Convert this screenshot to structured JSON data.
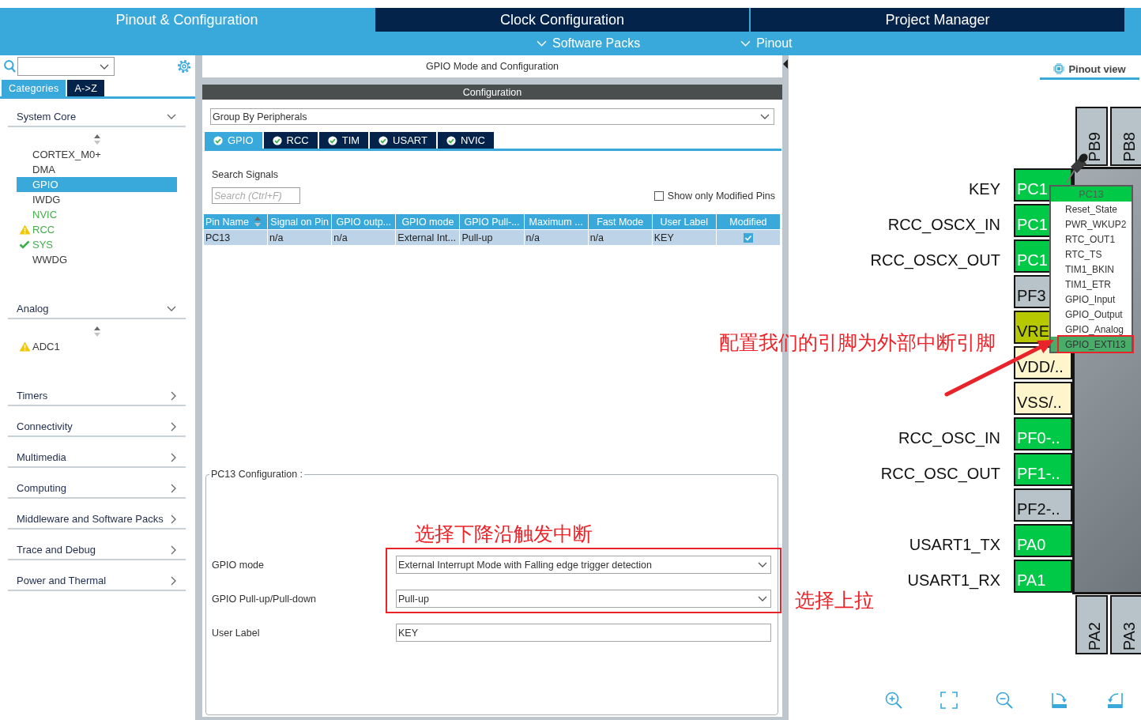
{
  "top_tabs": [
    {
      "label": "Pinout & Configuration",
      "selected": true
    },
    {
      "label": "Clock Configuration",
      "selected": false
    },
    {
      "label": "Project Manager",
      "selected": false
    }
  ],
  "menus": [
    {
      "label": "Software Packs"
    },
    {
      "label": "Pinout"
    }
  ],
  "sidebar": {
    "view_tabs": [
      {
        "label": "Categories",
        "selected": true
      },
      {
        "label": "A->Z",
        "selected": false
      }
    ],
    "categories": [
      {
        "label": "System Core",
        "expanded": true,
        "items": [
          {
            "label": "CORTEX_M0+",
            "selected": false,
            "configured": false,
            "kind": "plain"
          },
          {
            "label": "DMA",
            "selected": false,
            "configured": false,
            "kind": "plain"
          },
          {
            "label": "GPIO",
            "selected": true,
            "configured": false,
            "kind": "plain"
          },
          {
            "label": "IWDG",
            "selected": false,
            "configured": false,
            "kind": "plain"
          },
          {
            "label": "NVIC",
            "selected": false,
            "configured": true,
            "kind": "plain"
          },
          {
            "label": "RCC",
            "selected": false,
            "configured": true,
            "kind": "warning"
          },
          {
            "label": "SYS",
            "selected": false,
            "configured": true,
            "kind": "ok"
          },
          {
            "label": "WWDG",
            "selected": false,
            "configured": false,
            "kind": "plain"
          }
        ]
      },
      {
        "label": "Analog",
        "expanded": true,
        "items": [
          {
            "label": "ADC1",
            "selected": false,
            "configured": false,
            "kind": "warning"
          }
        ]
      },
      {
        "label": "Timers",
        "expanded": false
      },
      {
        "label": "Connectivity",
        "expanded": false
      },
      {
        "label": "Multimedia",
        "expanded": false
      },
      {
        "label": "Computing",
        "expanded": false
      },
      {
        "label": "Middleware and Software Packs",
        "expanded": false
      },
      {
        "label": "Trace and Debug",
        "expanded": false
      },
      {
        "label": "Power and Thermal",
        "expanded": false
      }
    ]
  },
  "config": {
    "title": "GPIO Mode and Configuration",
    "header": "Configuration",
    "group_by": "Group By Peripherals",
    "peripheral_tabs": [
      {
        "label": "GPIO",
        "selected": true
      },
      {
        "label": "RCC",
        "selected": false
      },
      {
        "label": "TIM",
        "selected": false
      },
      {
        "label": "USART",
        "selected": false
      },
      {
        "label": "NVIC",
        "selected": false
      }
    ],
    "search": {
      "label": "Search Signals",
      "placeholder": "Search (Ctrl+F)"
    },
    "modified_filter": {
      "label": "Show only Modified Pins",
      "checked": false
    },
    "table": {
      "columns": [
        "Pin Name",
        "Signal on Pin",
        "GPIO outp...",
        "GPIO mode",
        "GPIO Pull-...",
        "Maximum ...",
        "Fast Mode",
        "User Label",
        "Modified"
      ],
      "rows": [
        {
          "cells": [
            "PC13",
            "n/a",
            "n/a",
            "External Int...",
            "Pull-up",
            "n/a",
            "n/a",
            "KEY"
          ],
          "modified": true
        }
      ]
    },
    "pin_config": {
      "title": "PC13 Configuration :",
      "fields": [
        {
          "label": "GPIO mode",
          "kind": "dropdown",
          "value": "External Interrupt Mode with Falling edge trigger detection"
        },
        {
          "label": "GPIO Pull-up/Pull-down",
          "kind": "dropdown",
          "value": "Pull-up"
        },
        {
          "label": "User Label",
          "kind": "text",
          "value": "KEY"
        }
      ]
    }
  },
  "pinout": {
    "view_tab": {
      "label": "Pinout view",
      "selected": true
    },
    "top_pins": [
      {
        "name": "PB9",
        "kind": "unused"
      },
      {
        "name": "PB8",
        "kind": "unused"
      }
    ],
    "left_pins": [
      {
        "signal": "KEY",
        "name": "PC1",
        "kind": "assigned"
      },
      {
        "signal": "RCC_OSCX_IN",
        "name": "PC1",
        "kind": "assigned"
      },
      {
        "signal": "RCC_OSCX_OUT",
        "name": "PC1",
        "kind": "assigned"
      },
      {
        "name": "PF3",
        "kind": "unused"
      },
      {
        "name": "VRE",
        "kind": "reference"
      },
      {
        "name": "VDD/..",
        "kind": "power"
      },
      {
        "name": "VSS/..",
        "kind": "power"
      },
      {
        "signal": "RCC_OSC_IN",
        "name": "PF0-..",
        "kind": "assigned"
      },
      {
        "signal": "RCC_OSC_OUT",
        "name": "PF1-..",
        "kind": "assigned"
      },
      {
        "name": "PF2-..",
        "kind": "unused"
      },
      {
        "signal": "USART1_TX",
        "name": "PA0",
        "kind": "assigned"
      },
      {
        "signal": "USART1_RX",
        "name": "PA1",
        "kind": "assigned"
      }
    ],
    "bottom_pins": [
      {
        "name": "PA2",
        "kind": "unused"
      },
      {
        "name": "PA3",
        "kind": "unused"
      }
    ],
    "pin_menu": {
      "title": "PC13",
      "items": [
        {
          "label": "Reset_State",
          "selected": false
        },
        {
          "label": "PWR_WKUP2",
          "selected": false
        },
        {
          "label": "RTC_OUT1",
          "selected": false
        },
        {
          "label": "RTC_TS",
          "selected": false
        },
        {
          "label": "TIM1_BKIN",
          "selected": false
        },
        {
          "label": "TIM1_ETR",
          "selected": false
        },
        {
          "label": "GPIO_Input",
          "selected": false
        },
        {
          "label": "GPIO_Output",
          "selected": false
        },
        {
          "label": "GPIO_Analog",
          "selected": false
        },
        {
          "label": "GPIO_EXTI13",
          "selected": true
        }
      ]
    },
    "toolbar": [
      {
        "kind": "zoom-in"
      },
      {
        "kind": "fit"
      },
      {
        "kind": "zoom-out"
      },
      {
        "kind": "rotate-right"
      },
      {
        "kind": "rotate-left"
      }
    ]
  },
  "annotations": [
    {
      "kind": "mode-note",
      "text": "选择下降沿触发中断"
    },
    {
      "kind": "pin-note",
      "text": "配置我们的引脚为外部中断引脚"
    },
    {
      "kind": "pull-note",
      "text": "选择上拉"
    }
  ]
}
